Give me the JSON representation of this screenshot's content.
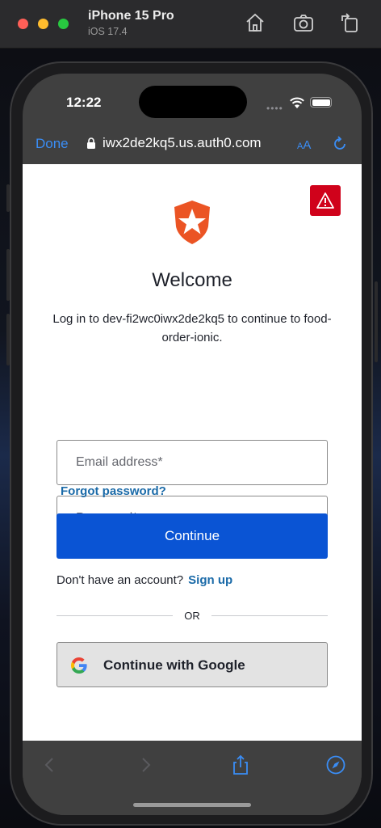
{
  "simulator": {
    "device_name": "iPhone 15 Pro",
    "os_version": "iOS 17.4",
    "icons": [
      "home-icon",
      "screenshot-icon",
      "rotate-icon"
    ]
  },
  "status_bar": {
    "time": "12:22",
    "signal": "••••"
  },
  "browser": {
    "done_label": "Done",
    "url": "iwx2de2kq5.us.auth0.com",
    "text_size_label": "A",
    "text_size_label_small": "A"
  },
  "login": {
    "title": "Welcome",
    "subtitle": "Log in to dev-fi2wc0iwx2de2kq5 to continue to food-order-ionic.",
    "email_placeholder": "Email address*",
    "password_placeholder": "Password*",
    "forgot_password": "Forgot password?",
    "continue_label": "Continue",
    "no_account_text": "Don't have an account?",
    "signup_label": "Sign up",
    "or_text": "OR",
    "google_label": "Continue with Google"
  },
  "colors": {
    "primary": "#0a54d4",
    "link": "#1a6aa8",
    "warning": "#d0021b",
    "brand_logo": "#eb5424",
    "ios_accent": "#3a8df5"
  }
}
